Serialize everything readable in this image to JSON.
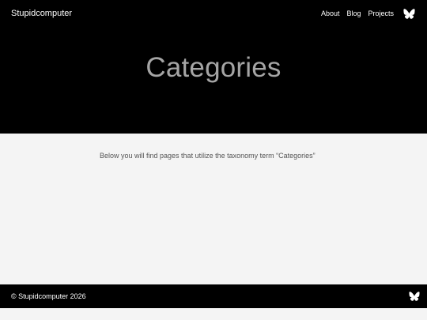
{
  "header": {
    "site_title": "Stupidcomputer",
    "nav": [
      "About",
      "Blog",
      "Projects"
    ],
    "social_icon": "bluesky-butterfly-icon"
  },
  "hero": {
    "title": "Categories"
  },
  "main": {
    "intro": "Below you will find pages that utilize the taxonomy term “Categories”"
  },
  "footer": {
    "copyright": "© Stupidcomputer 2026",
    "social_icon": "bluesky-butterfly-icon"
  },
  "colors": {
    "hero_bg": "#000000",
    "title": "#a5a5a5",
    "body_bg": "#f4f4f4",
    "footer_bg": "#000000"
  }
}
